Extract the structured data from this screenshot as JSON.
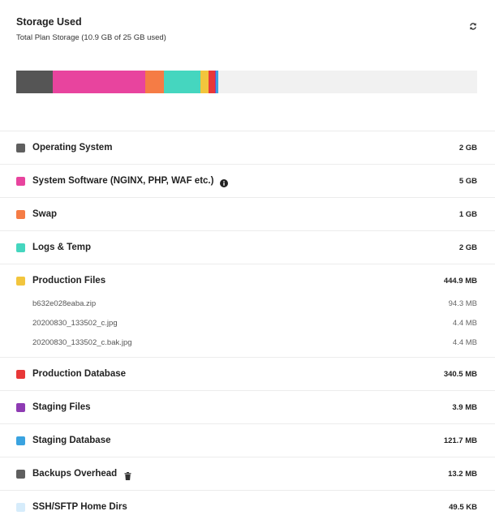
{
  "header": {
    "title": "Storage Used",
    "subtitle": "Total Plan Storage (10.9 GB of 25 GB used)"
  },
  "usage_bar": {
    "total_gb": 25,
    "segments": [
      {
        "name": "Operating System",
        "fraction": 0.08,
        "color": "#555555"
      },
      {
        "name": "System Software",
        "fraction": 0.2,
        "color": "#e8449e"
      },
      {
        "name": "Swap",
        "fraction": 0.04,
        "color": "#f57c45"
      },
      {
        "name": "Logs & Temp",
        "fraction": 0.08,
        "color": "#45d6bf"
      },
      {
        "name": "Production Files",
        "fraction": 0.0178,
        "color": "#f2c53d"
      },
      {
        "name": "Production Database",
        "fraction": 0.0136,
        "color": "#e83838"
      },
      {
        "name": "Staging Files",
        "fraction": 0.002,
        "color": "#8e3bb3"
      },
      {
        "name": "Staging Database",
        "fraction": 0.0049,
        "color": "#3aa3e0"
      }
    ]
  },
  "items": [
    {
      "label": "Operating System",
      "value": "2 GB",
      "color": "#5f5f5f"
    },
    {
      "label": "System Software (NGINX, PHP, WAF etc.)",
      "value": "5 GB",
      "color": "#e8449e",
      "icon": "info-icon"
    },
    {
      "label": "Swap",
      "value": "1 GB",
      "color": "#f57c45"
    },
    {
      "label": "Logs & Temp",
      "value": "2 GB",
      "color": "#45d6bf"
    },
    {
      "label": "Production Files",
      "value": "444.9 MB",
      "color": "#f2c53d",
      "files": [
        {
          "name": "b632e028eaba.zip",
          "size": "94.3 MB"
        },
        {
          "name": "20200830_133502_c.jpg",
          "size": "4.4 MB"
        },
        {
          "name": "20200830_133502_c.bak.jpg",
          "size": "4.4 MB"
        }
      ]
    },
    {
      "label": "Production Database",
      "value": "340.5 MB",
      "color": "#e83838"
    },
    {
      "label": "Staging Files",
      "value": "3.9 MB",
      "color": "#8e3bb3"
    },
    {
      "label": "Staging Database",
      "value": "121.7 MB",
      "color": "#3aa3e0"
    },
    {
      "label": "Backups Overhead",
      "value": "13.2 MB",
      "color": "#5f5f5f",
      "icon": "trash-icon"
    },
    {
      "label": "SSH/SFTP Home Dirs",
      "value": "49.5 KB",
      "color": "#d6ecfb"
    }
  ]
}
